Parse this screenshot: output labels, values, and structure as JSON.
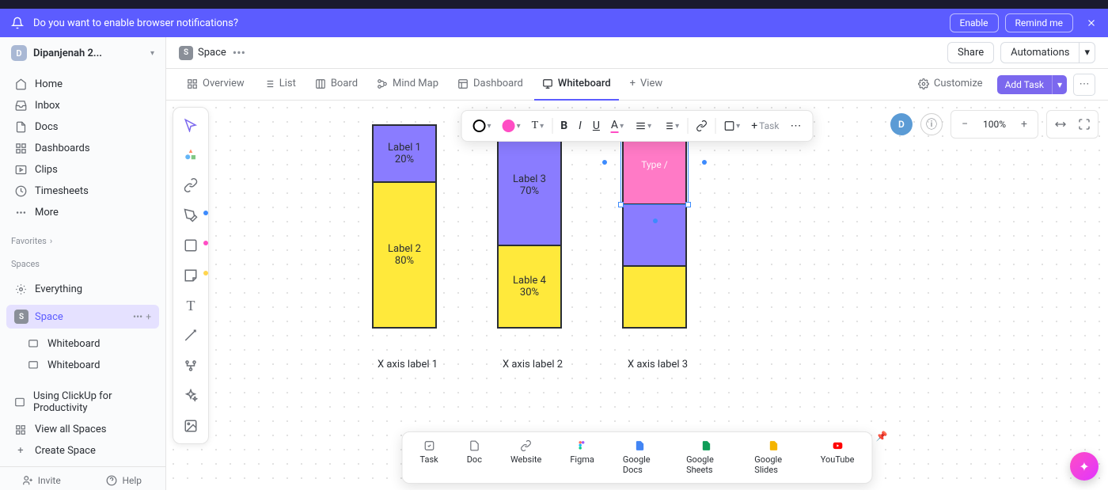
{
  "notif": {
    "text": "Do you want to enable browser notifications?",
    "enable": "Enable",
    "remind": "Remind me"
  },
  "workspace": {
    "initial": "D",
    "name": "Dipanjenah 2..."
  },
  "nav": {
    "home": "Home",
    "inbox": "Inbox",
    "docs": "Docs",
    "dashboards": "Dashboards",
    "clips": "Clips",
    "timesheets": "Timesheets",
    "more": "More"
  },
  "sections": {
    "favorites": "Favorites",
    "spaces": "Spaces"
  },
  "spaces": {
    "everything": "Everything",
    "space": "Space",
    "whiteboard1": "Whiteboard",
    "whiteboard2": "Whiteboard",
    "using": "Using ClickUp for Productivity",
    "viewall": "View all Spaces",
    "create": "Create Space"
  },
  "footer": {
    "invite": "Invite",
    "help": "Help"
  },
  "breadcrumb": {
    "space": "Space"
  },
  "topright": {
    "share": "Share",
    "automations": "Automations"
  },
  "views": {
    "overview": "Overview",
    "list": "List",
    "board": "Board",
    "mindmap": "Mind Map",
    "dashboard": "Dashboard",
    "whiteboard": "Whiteboard",
    "addview": "View",
    "customize": "Customize",
    "addtask": "Add Task"
  },
  "zoom": {
    "value": "100%",
    "avatar": "D"
  },
  "floatbar": {
    "task": "Task"
  },
  "chart_data": {
    "type": "bar",
    "stacked": true,
    "categories": [
      "X axis label 1",
      "X axis label 2",
      "X axis label 3"
    ],
    "series": [
      {
        "segments": [
          {
            "label": "Label 1",
            "value": 20,
            "color": "purple"
          },
          {
            "label": "Label 2",
            "value": 80,
            "color": "yellow"
          }
        ]
      },
      {
        "segments": [
          {
            "label": "Label 3",
            "value": 70,
            "color": "purple"
          },
          {
            "label": "Lable 4",
            "value": 30,
            "color": "yellow"
          }
        ]
      },
      {
        "segments": [
          {
            "label": "",
            "value": null,
            "color": "pink",
            "placeholder": "Type /"
          },
          {
            "label": "",
            "value": null,
            "color": "purple"
          },
          {
            "label": "",
            "value": null,
            "color": "yellow"
          }
        ]
      }
    ]
  },
  "bottom": {
    "task": "Task",
    "doc": "Doc",
    "website": "Website",
    "figma": "Figma",
    "gdocs": "Google Docs",
    "gsheets": "Google Sheets",
    "gslides": "Google Slides",
    "youtube": "YouTube"
  }
}
